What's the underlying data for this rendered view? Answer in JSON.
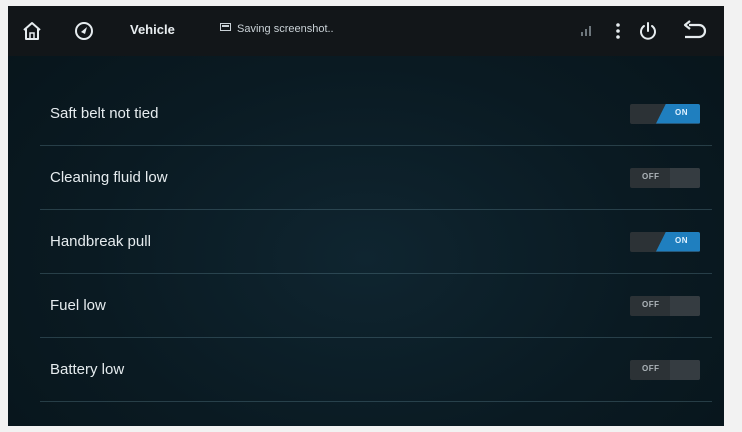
{
  "header": {
    "title": "Vehicle",
    "notification": "Saving screenshot..",
    "icons": {
      "home": "home-icon",
      "circle": "navigation-icon",
      "notification": "screenshot-icon",
      "signal": "signal-icon",
      "menu": "more-vert-icon",
      "power": "power-icon",
      "back": "back-icon"
    }
  },
  "settings": [
    {
      "label": "Saft belt not tied",
      "state": "ON"
    },
    {
      "label": "Cleaning fluid low",
      "state": "OFF"
    },
    {
      "label": "Handbreak pull",
      "state": "ON"
    },
    {
      "label": "Fuel low",
      "state": "OFF"
    },
    {
      "label": "Battery low",
      "state": "OFF"
    }
  ],
  "colors": {
    "accent": "#1f7fbf",
    "background": "#0a1a22",
    "topbar": "#121619"
  }
}
